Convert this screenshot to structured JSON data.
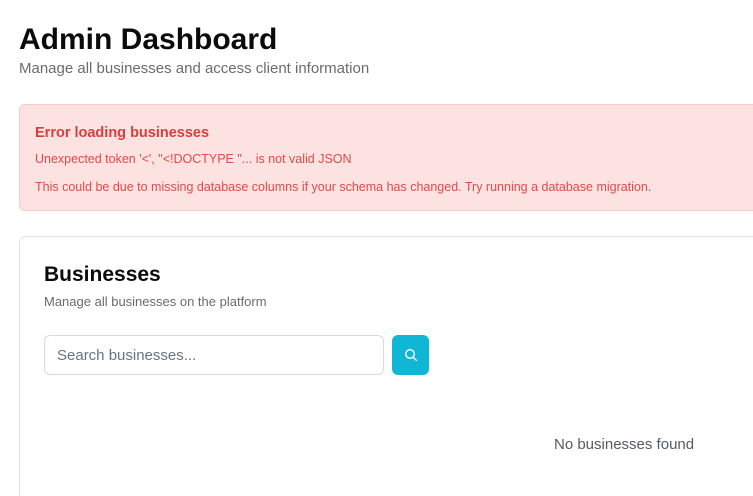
{
  "header": {
    "title": "Admin Dashboard",
    "subtitle": "Manage all businesses and access client information"
  },
  "error": {
    "title": "Error loading businesses",
    "message": "Unexpected token '<', \"<!DOCTYPE \"... is not valid JSON",
    "hint": "This could be due to missing database columns if your schema has changed. Try running a database migration."
  },
  "businesses": {
    "title": "Businesses",
    "subtitle": "Manage all businesses on the platform",
    "search": {
      "placeholder": "Search businesses...",
      "value": ""
    },
    "search_button_icon": "search-icon",
    "empty_message": "No businesses found"
  },
  "colors": {
    "error_bg": "#fde2e2",
    "error_text": "#dc3c3c",
    "accent": "#0fb6d6"
  }
}
